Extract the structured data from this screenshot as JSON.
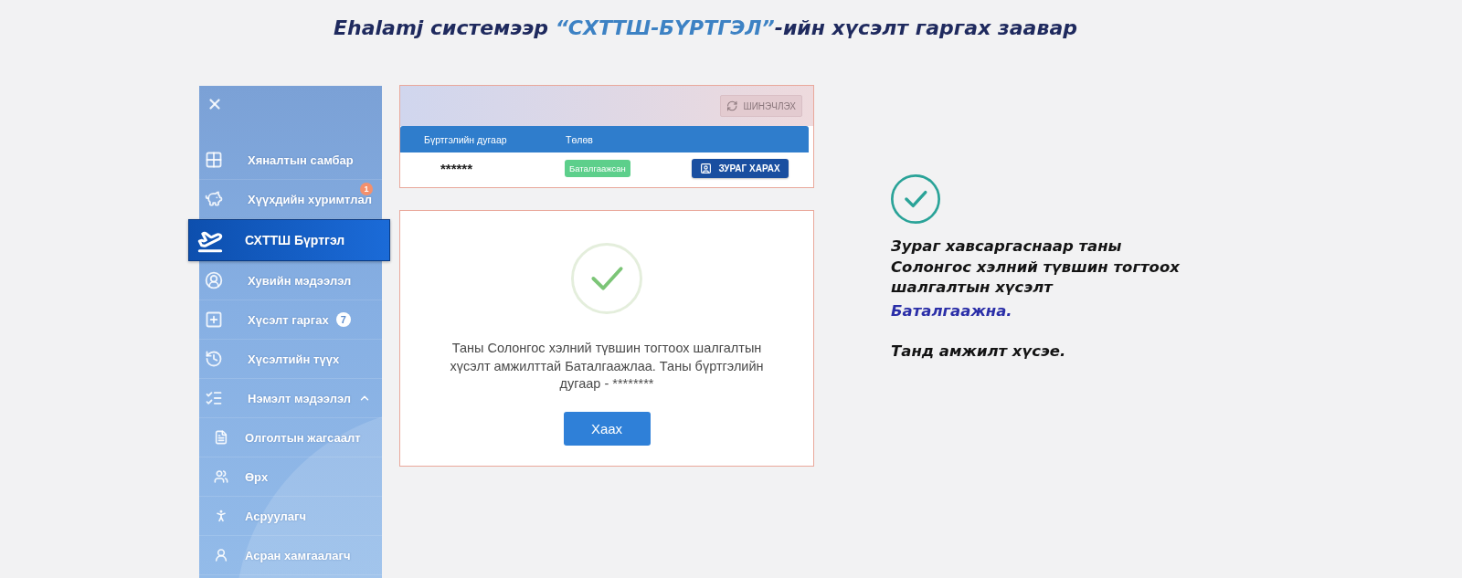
{
  "title": {
    "parts": [
      {
        "text": "Ehalamj системээр ",
        "highlight": false
      },
      {
        "text": "“СХТТШ-БҮРТГЭЛ”",
        "highlight": true
      },
      {
        "text": "-ийн хүсэлт гаргах заавар",
        "highlight": false
      }
    ]
  },
  "sidebar": {
    "items": [
      {
        "kind": "link",
        "label": "Хяналтын самбар",
        "selected": false
      },
      {
        "kind": "link",
        "label": "Хүүхдийн хуримтлал",
        "selected": false,
        "badge": {
          "kind": "notification",
          "text": "1",
          "color": "#f4906c"
        }
      },
      {
        "kind": "link",
        "label": "СХТТШ Бүртгэл",
        "selected": true
      },
      {
        "kind": "link",
        "label": "Хувийн мэдээлэл",
        "selected": false
      },
      {
        "kind": "link",
        "label": "Хүсэлт гаргах",
        "selected": false,
        "badge": {
          "kind": "count",
          "text": "7",
          "color": "#ffffff"
        }
      },
      {
        "kind": "link",
        "label": "Хүсэлтийн түүх",
        "selected": false
      },
      {
        "kind": "group",
        "label": "Нэмэлт мэдээлэл",
        "selected": false,
        "expanded": true,
        "children": [
          {
            "label": "Олголтын жагсаалт",
            "selected": false
          },
          {
            "label": "Өрх",
            "selected": false
          },
          {
            "label": "Асруулагч",
            "selected": false
          },
          {
            "label": "Асран хамгаалагч",
            "selected": false
          }
        ]
      }
    ]
  },
  "top_panel": {
    "refresh_button": {
      "label": "ШИНЭЧЛЭХ",
      "disabled": true
    },
    "table": {
      "columns": [
        "Бүртгэлийн дугаар",
        "Төлөв"
      ],
      "rows": [
        {
          "number": "******",
          "status": "Баталгаажсан",
          "action": "ЗУРАГ ХАРАХ"
        }
      ]
    }
  },
  "dialog": {
    "message": "Таны Солонгос хэлний түвшин тогтоох шалгалтын хүсэлт амжилттай Баталгаажлаа. Таны бүртгэлийн дугаар - ********",
    "button": "Хаах"
  },
  "confirmation": {
    "parts": [
      {
        "text": "Зураг хавсаргаснаар таны Солонгос хэлний түвшин тогтоох шалгалтын хүсэлт ",
        "highlight": false
      },
      {
        "text": "Баталгаажна.",
        "highlight": true
      }
    ],
    "closing": "Танд амжилт хүсэе."
  }
}
